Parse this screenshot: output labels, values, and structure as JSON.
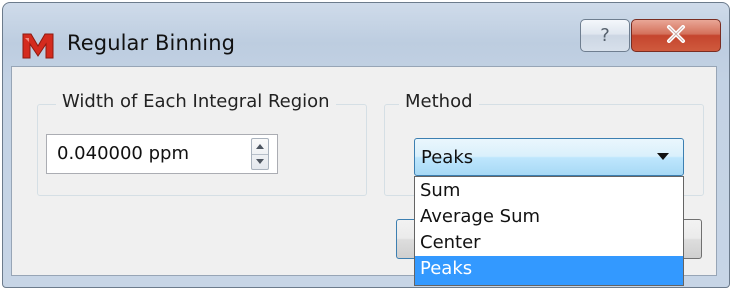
{
  "window": {
    "title": "Regular Binning",
    "help_label": "?",
    "icons": {
      "app": "mnova-logo-icon",
      "help": "help-icon",
      "close": "close-icon"
    }
  },
  "width_group": {
    "title": "Width of Each Integral Region",
    "value": "0.040000 ppm"
  },
  "method_group": {
    "title": "Method",
    "selected": "Peaks",
    "options": [
      "Sum",
      "Average Sum",
      "Center",
      "Peaks"
    ]
  },
  "colors": {
    "selection": "#3399ff",
    "close_button": "#c5452e",
    "app_icon": "#d42b1e"
  }
}
